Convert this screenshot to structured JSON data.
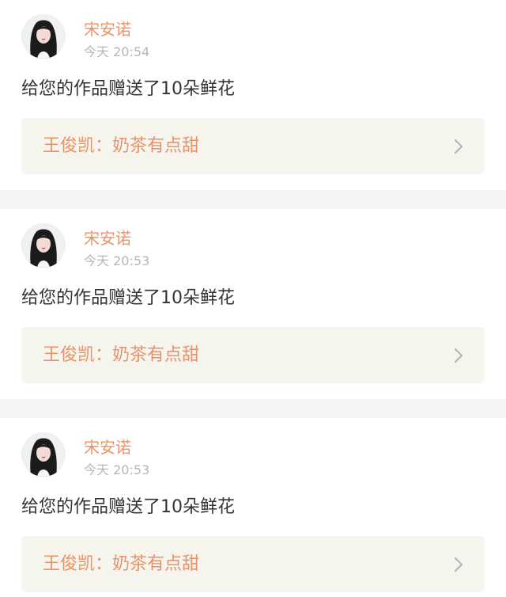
{
  "notifications": [
    {
      "username": "宋安诺",
      "time": "今天 20:54",
      "message": "给您的作品赠送了10朵鲜花",
      "work_title": "王俊凯：奶茶有点甜"
    },
    {
      "username": "宋安诺",
      "time": "今天 20:53",
      "message": "给您的作品赠送了10朵鲜花",
      "work_title": "王俊凯：奶茶有点甜"
    },
    {
      "username": "宋安诺",
      "time": "今天 20:53",
      "message": "给您的作品赠送了10朵鲜花",
      "work_title": "王俊凯：奶茶有点甜"
    }
  ],
  "icons": {
    "avatar": "user-avatar-photo",
    "chevron": "chevron-right-icon"
  },
  "colors": {
    "username": "#e8946a",
    "time": "#b6b6b6",
    "message": "#333333",
    "work_box_bg": "#f5f5ee",
    "work_title": "#e6946b",
    "divider": "#f4f4f4"
  }
}
